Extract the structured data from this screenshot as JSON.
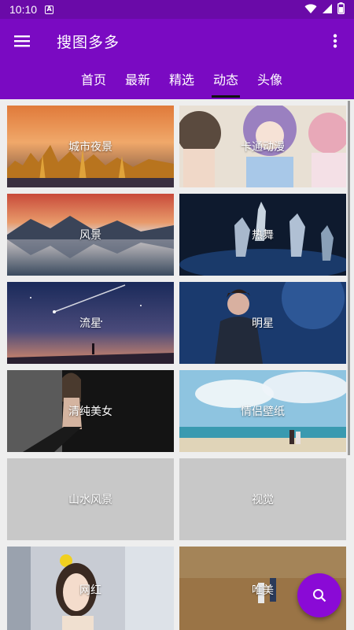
{
  "status": {
    "time": "10:10",
    "app_badge": "A"
  },
  "app": {
    "title": "搜图多多"
  },
  "tabs": [
    "首页",
    "最新",
    "精选",
    "动态",
    "头像"
  ],
  "active_tab": "动态",
  "tiles": [
    "城市夜景",
    "卡通动漫",
    "风景",
    "热舞",
    "流星",
    "明星",
    "清纯美女",
    "情侣壁纸",
    "山水风景",
    "视觉",
    "网红",
    "唯美"
  ],
  "icons": {
    "menu": "menu-icon",
    "more": "more-vert-icon",
    "search": "search-icon",
    "wifi": "wifi-icon",
    "signal": "signal-icon",
    "battery": "battery-icon"
  },
  "colors": {
    "status_bar": "#6a0aa8",
    "app_bar": "#7a0ac2",
    "fab": "#8a0ad6",
    "placeholder": "#c8c8c8"
  }
}
